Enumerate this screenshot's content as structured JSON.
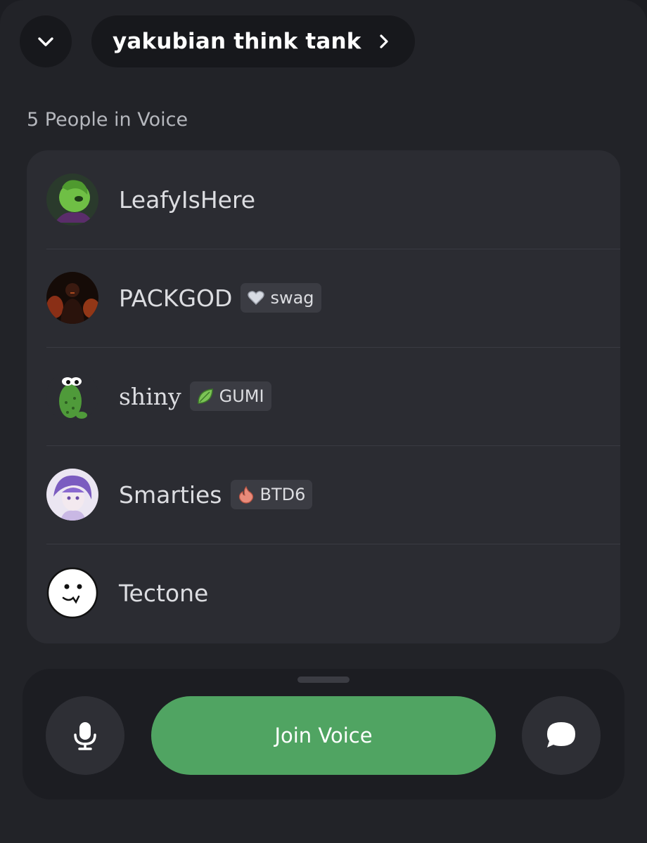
{
  "header": {
    "channel_name": "yakubian think tank"
  },
  "voice": {
    "section_label": "5 People in Voice",
    "people": [
      {
        "name": "LeafyIsHere",
        "tag": null
      },
      {
        "name": "PACKGOD",
        "tag": {
          "text": "swag",
          "icon": "heart-icon"
        }
      },
      {
        "name": "shiny",
        "tag": {
          "text": "GUMI",
          "icon": "leaf-icon"
        }
      },
      {
        "name": "Smarties",
        "tag": {
          "text": "BTD6",
          "icon": "flame-icon"
        }
      },
      {
        "name": "Tectone",
        "tag": null
      }
    ]
  },
  "dock": {
    "join_label": "Join Voice",
    "accent_color": "#50a462"
  }
}
